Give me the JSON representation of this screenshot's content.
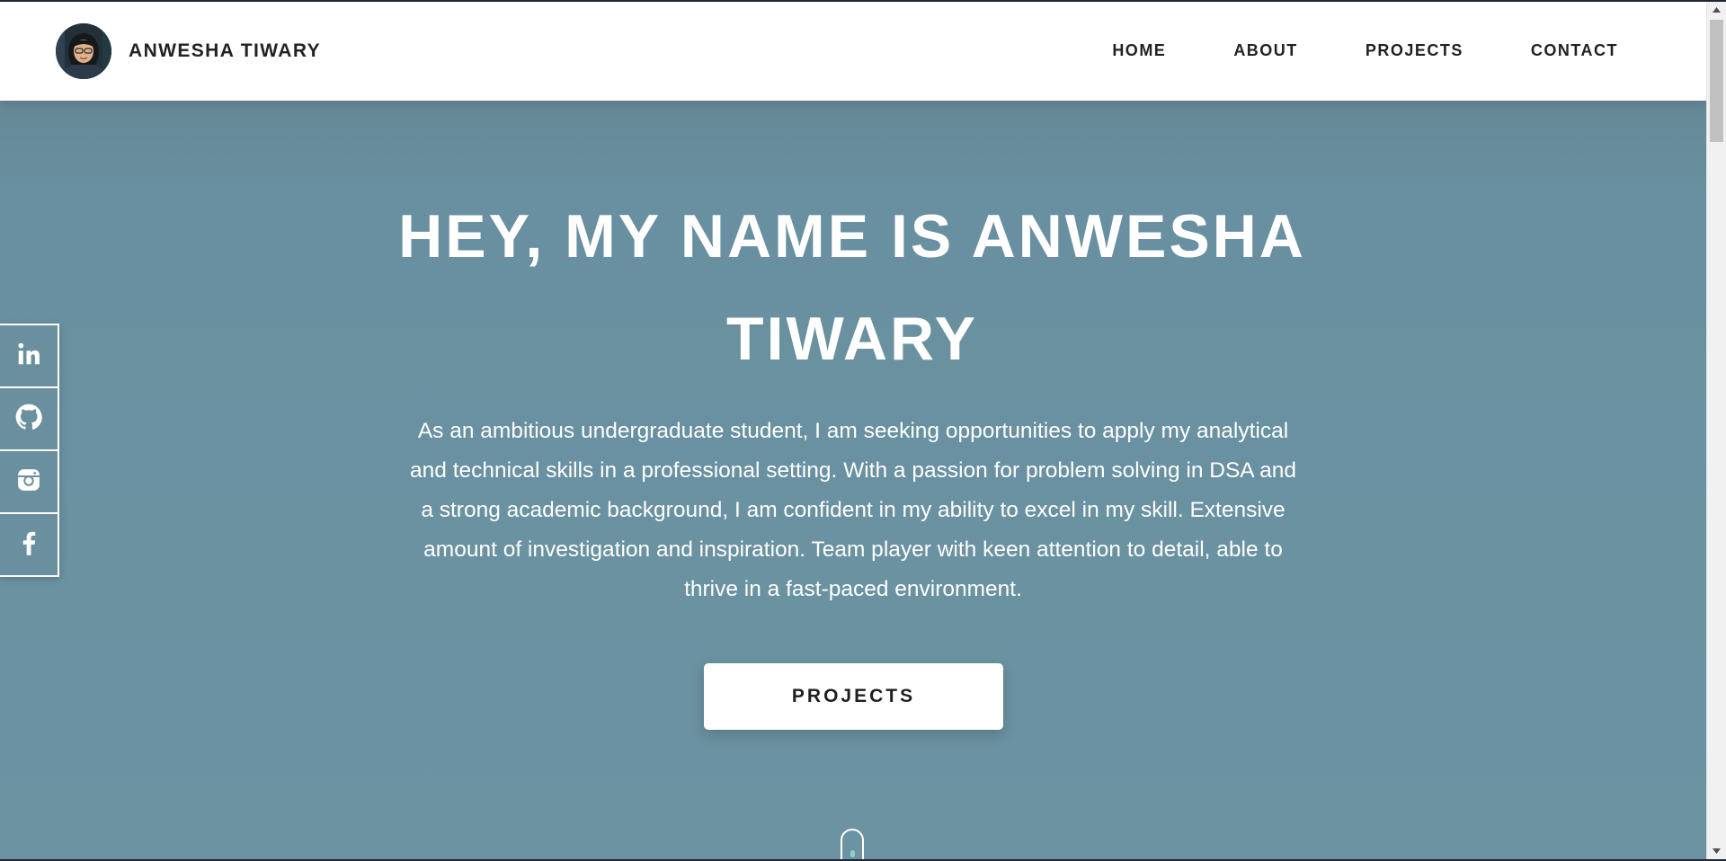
{
  "site": {
    "brand_name": "ANWESHA TIWARY"
  },
  "nav": {
    "items": [
      {
        "label": "HOME"
      },
      {
        "label": "ABOUT"
      },
      {
        "label": "PROJECTS"
      },
      {
        "label": "CONTACT"
      }
    ]
  },
  "hero": {
    "title_line1": "HEY, MY NAME IS ANWESHA",
    "title_line2": "TIWARY",
    "description": "As an ambitious undergraduate student, I am seeking opportunities to apply my analytical and technical skills in a professional setting. With a passion for problem solving in DSA and a strong academic background, I am confident in my ability to excel in my skill. Extensive amount of investigation and inspiration. Team player with keen attention to detail, able to thrive in a fast-paced environment.",
    "cta_label": "PROJECTS"
  },
  "social": {
    "icons": [
      "linkedin-icon",
      "github-icon",
      "instagram-icon",
      "facebook-icon"
    ]
  },
  "colors": {
    "hero_background": "#6b93a2",
    "header_background": "#ffffff",
    "text_dark": "#222222",
    "text_light": "#ffffff",
    "scroll_dot_accent": "#8fd3c6"
  }
}
